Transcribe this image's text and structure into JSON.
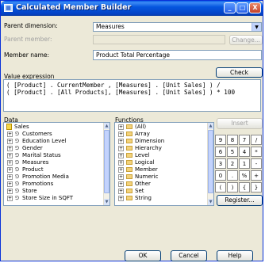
{
  "window": {
    "title": "Calculated Member Builder",
    "minimize": "_",
    "maximize": "□",
    "close": "X"
  },
  "form": {
    "parent_dimension_label": "Parent dimension:",
    "parent_dimension_value": "Measures",
    "parent_member_label": "Parent member:",
    "parent_member_value": "",
    "change_button": "Change...",
    "member_name_label": "Member name:",
    "member_name_value": "Product Total Percentage"
  },
  "expression": {
    "label": "Value expression",
    "check_button": "Check",
    "lines": [
      "( [Product] . CurrentMember , [Measures] . [Unit Sales] ) /",
      "( [Product] . [All Products], [Measures] . [Unit Sales] ) * 100"
    ]
  },
  "data_panel": {
    "label": "Data",
    "root": "Sales",
    "items": [
      "Customers",
      "Education Level",
      "Gender",
      "Marital Status",
      "Measures",
      "Product",
      "Promotion Media",
      "Promotions",
      "Store",
      "Store Size in SQFT"
    ]
  },
  "functions_panel": {
    "label": "Functions",
    "items": [
      "(All)",
      "Array",
      "Dimension",
      "Hierarchy",
      "Level",
      "Logical",
      "Member",
      "Numeric",
      "Other",
      "Set",
      "String"
    ]
  },
  "insert_button": "Insert",
  "keypad": [
    "9",
    "8",
    "7",
    "/",
    "6",
    "5",
    "4",
    "*",
    "3",
    "2",
    "1",
    "-",
    "0",
    ".",
    "%",
    "+",
    "(",
    ")",
    "{",
    "}"
  ],
  "register_button": "Register...",
  "footer": {
    "ok": "OK",
    "cancel": "Cancel",
    "help": "Help"
  },
  "icons": {
    "app": "window-app-icon",
    "dimension": "dimension-icon",
    "folder": "folder-icon",
    "cube": "cube-icon"
  }
}
